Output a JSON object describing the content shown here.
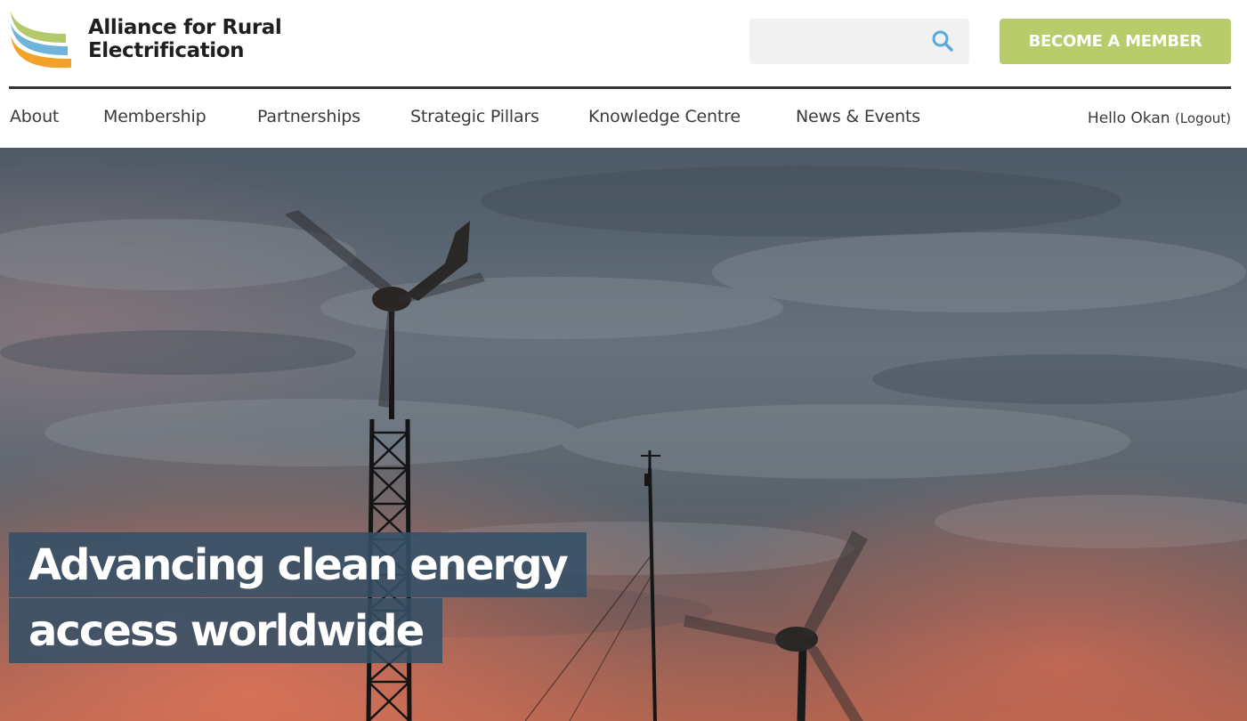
{
  "site": {
    "name_line1": "Alliance for Rural",
    "name_line2": "Electrification"
  },
  "search": {
    "placeholder": "",
    "value": "",
    "icon": "search-icon"
  },
  "header": {
    "cta_label": "BECOME A MEMBER"
  },
  "nav": {
    "items": [
      {
        "label": "About"
      },
      {
        "label": "Membership"
      },
      {
        "label": "Partnerships"
      },
      {
        "label": "Strategic Pillars"
      },
      {
        "label": "Knowledge Centre"
      },
      {
        "label": "News & Events"
      }
    ]
  },
  "user": {
    "greeting": "Hello Okan",
    "logout_label": "(Logout)"
  },
  "hero": {
    "headline_line1": "Advancing clean energy",
    "headline_line2": "access worldwide"
  },
  "colors": {
    "brand_green": "#b8cc6c",
    "brand_blue": "#6fb4db",
    "brand_orange": "#f2a129",
    "search_icon": "#5aa9d6",
    "headline_bg": "#345066"
  }
}
